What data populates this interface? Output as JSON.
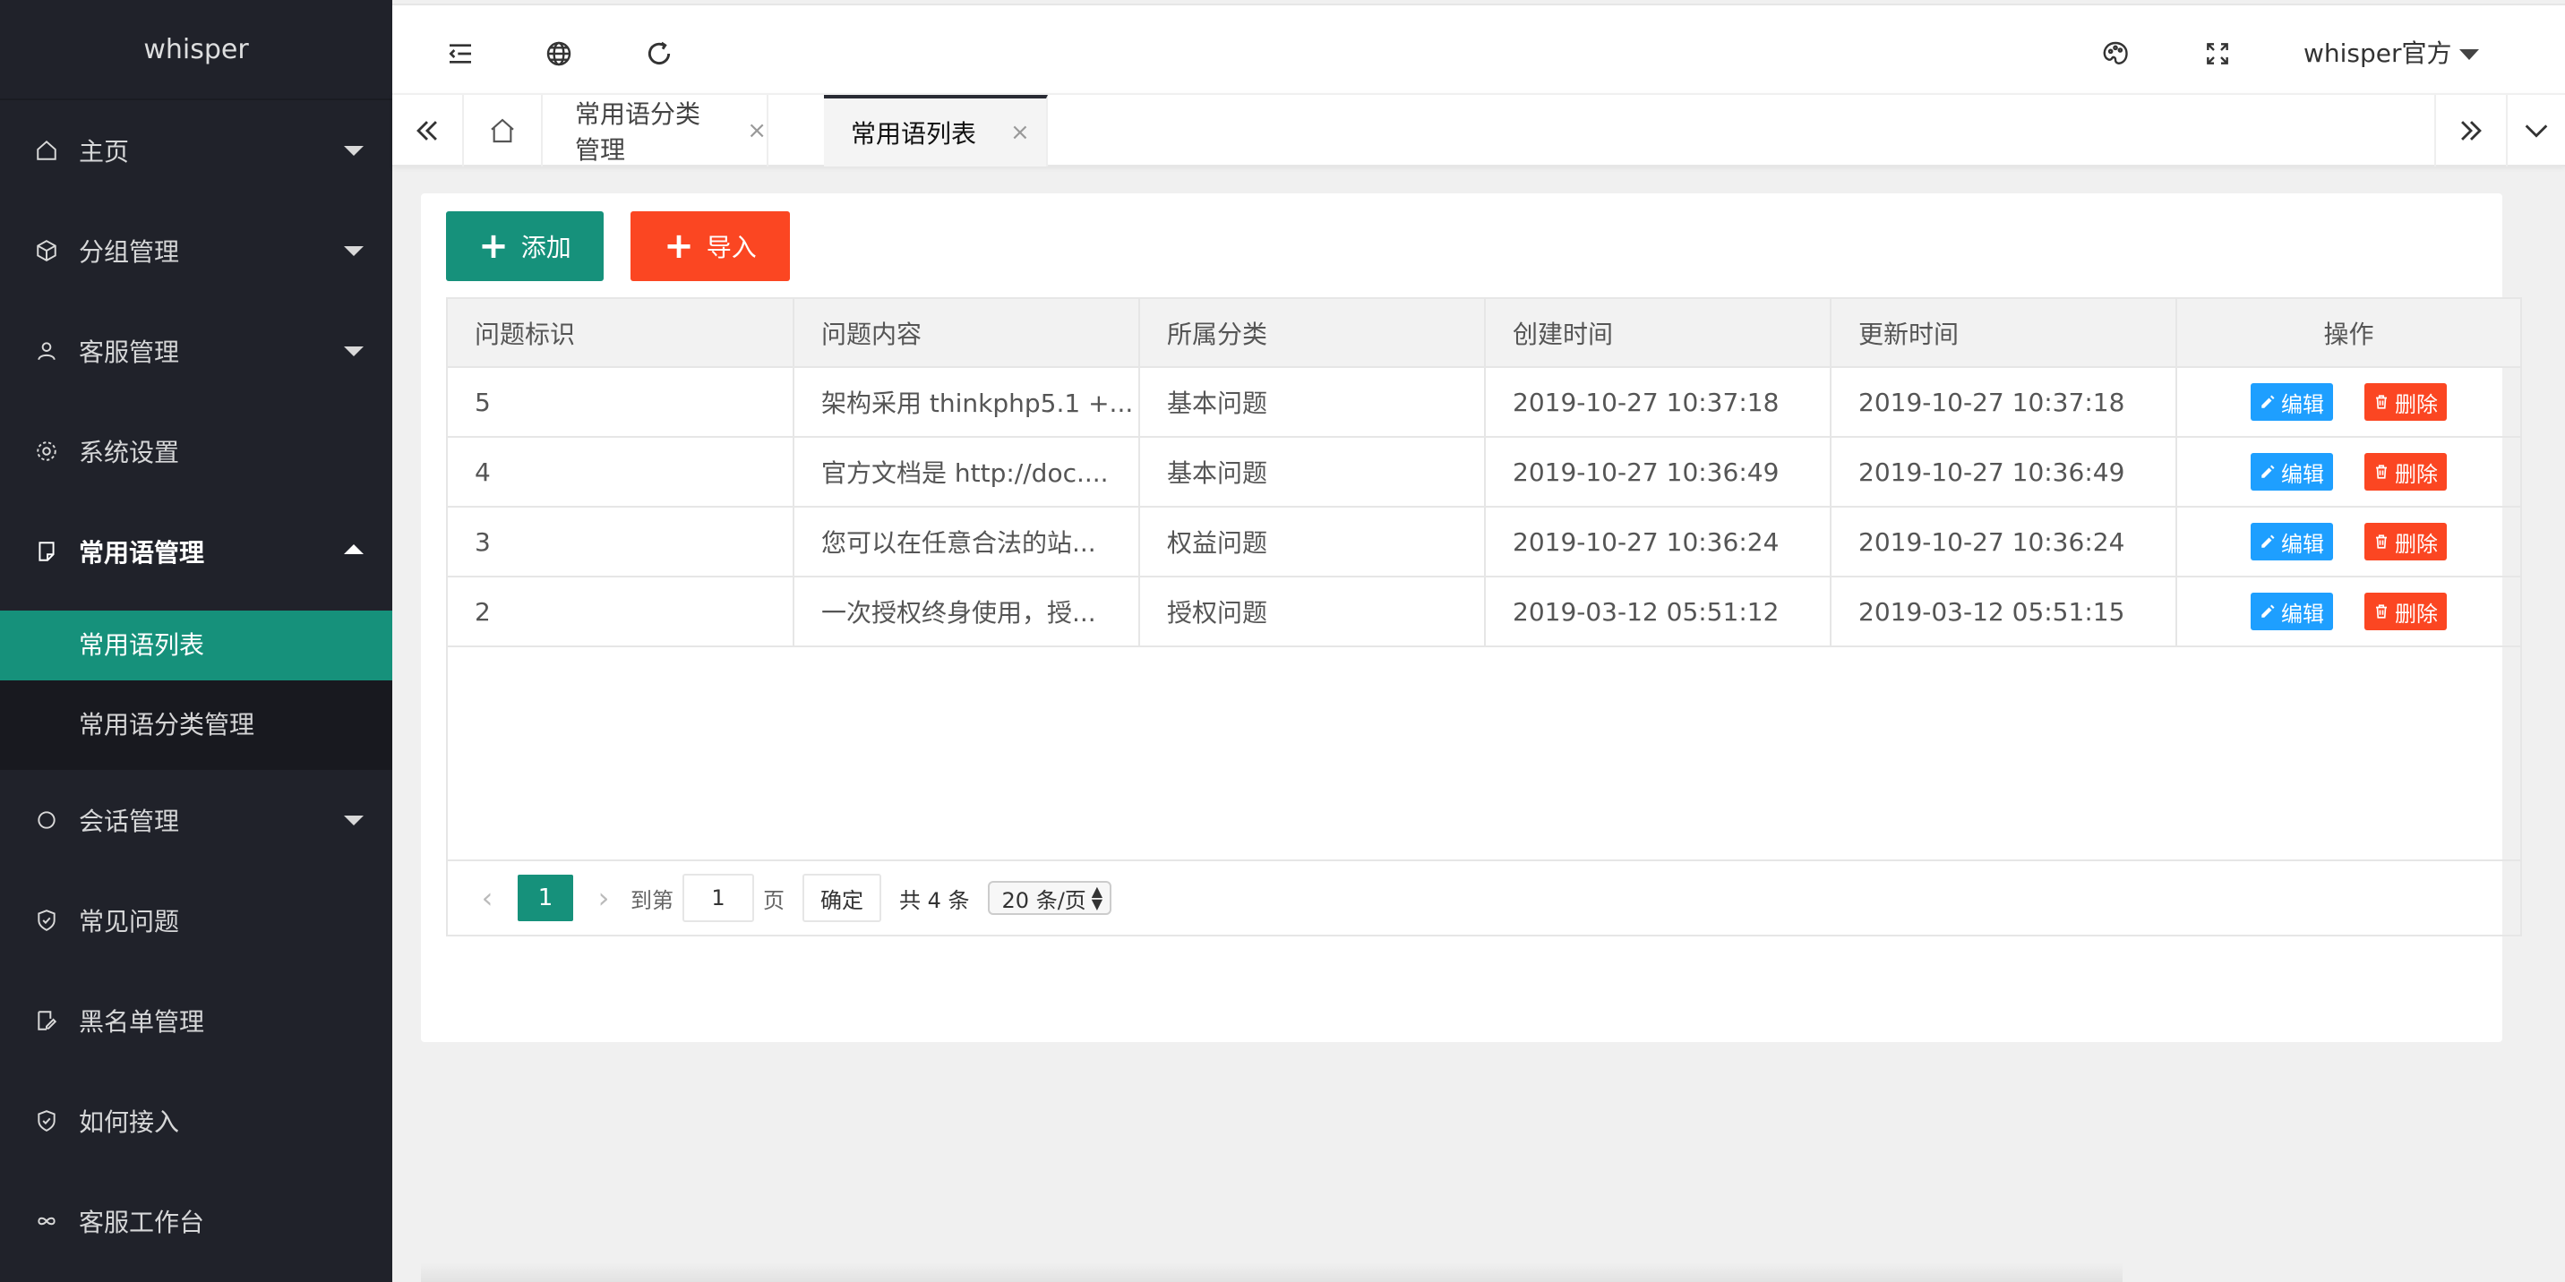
{
  "app": {
    "logo": "whisper"
  },
  "sidebar": {
    "items": [
      {
        "label": "主页",
        "icon": "home-icon",
        "caret": "down"
      },
      {
        "label": "分组管理",
        "icon": "cube-icon",
        "caret": "down"
      },
      {
        "label": "客服管理",
        "icon": "user-icon",
        "caret": "down"
      },
      {
        "label": "系统设置",
        "icon": "gear-icon",
        "caret": ""
      },
      {
        "label": "常用语管理",
        "icon": "note-icon",
        "caret": "up"
      },
      {
        "label": "会话管理",
        "icon": "chat-icon",
        "caret": "down"
      },
      {
        "label": "常见问题",
        "icon": "shield-icon",
        "caret": ""
      },
      {
        "label": "黑名单管理",
        "icon": "edit-icon",
        "caret": ""
      },
      {
        "label": "如何接入",
        "icon": "shield-icon",
        "caret": ""
      },
      {
        "label": "客服工作台",
        "icon": "link-icon",
        "caret": ""
      }
    ],
    "submenu": [
      {
        "label": "常用语列表",
        "active": true
      },
      {
        "label": "常用语分类管理",
        "active": false
      }
    ]
  },
  "header": {
    "user_name": "whisper官方"
  },
  "tabs": [
    {
      "label": "常用语分类管理",
      "active": false
    },
    {
      "label": "常用语列表",
      "active": true
    }
  ],
  "tab_close_glyph": "×",
  "toolbar": {
    "add_label": "添加",
    "import_label": "导入"
  },
  "table": {
    "columns": [
      "问题标识",
      "问题内容",
      "所属分类",
      "创建时间",
      "更新时间",
      "操作"
    ],
    "rows": [
      {
        "id": "5",
        "content": "架构采用 thinkphp5.1 +...",
        "category": "基本问题",
        "created": "2019-10-27 10:37:18",
        "updated": "2019-10-27 10:37:18"
      },
      {
        "id": "4",
        "content": "官方文档是 http://doc....",
        "category": "基本问题",
        "created": "2019-10-27 10:36:49",
        "updated": "2019-10-27 10:36:49"
      },
      {
        "id": "3",
        "content": "您可以在任意合法的站...",
        "category": "权益问题",
        "created": "2019-10-27 10:36:24",
        "updated": "2019-10-27 10:36:24"
      },
      {
        "id": "2",
        "content": "一次授权终身使用，授...",
        "category": "授权问题",
        "created": "2019-03-12 05:51:12",
        "updated": "2019-03-12 05:51:15"
      }
    ],
    "edit_label": "编辑",
    "delete_label": "删除"
  },
  "pager": {
    "current": "1",
    "goto_label": "到第",
    "page_input": "1",
    "page_unit": "页",
    "confirm_label": "确定",
    "total": "共 4 条",
    "page_size": "20 条/页"
  },
  "colors": {
    "sidebar_bg": "#20222a",
    "accent": "#16917b",
    "danger": "#fb4622",
    "info": "#1e9fff"
  }
}
